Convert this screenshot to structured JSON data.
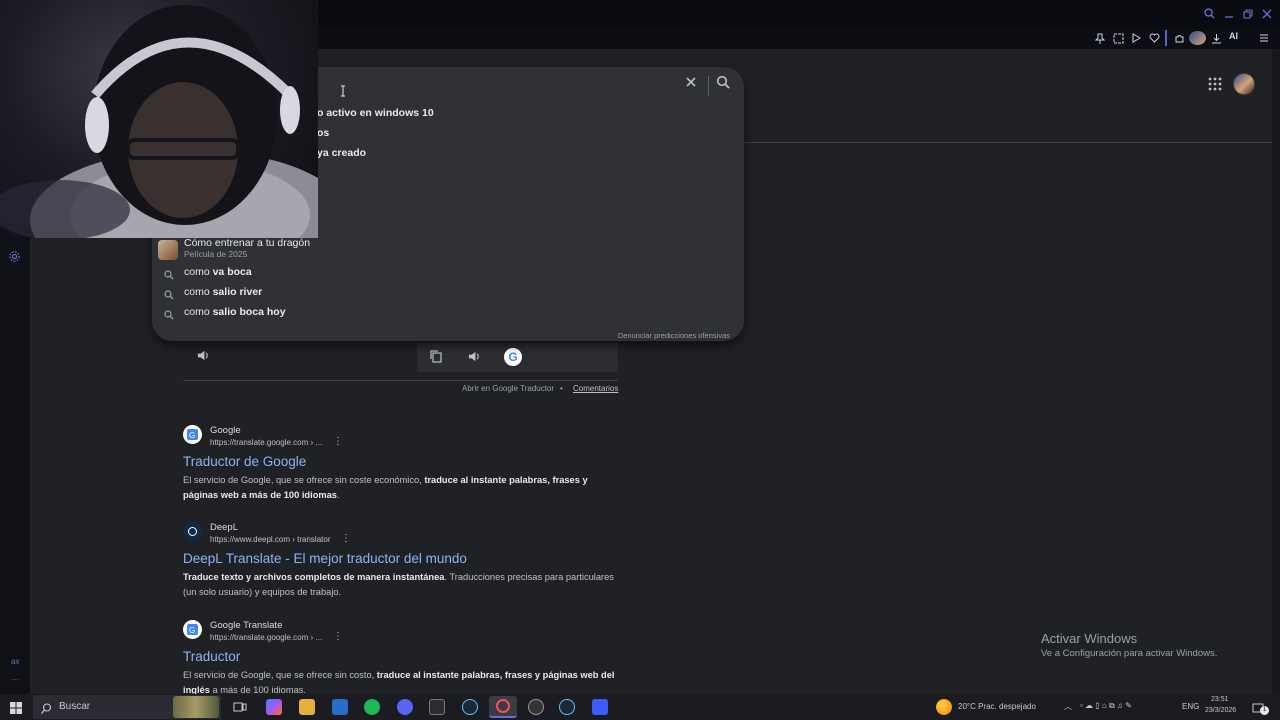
{
  "search": {
    "value": "",
    "suggestions": [
      {
        "prefix": "",
        "bold": "o activo en windows 10"
      },
      {
        "prefix": "",
        "bold": "os"
      },
      {
        "prefix": "",
        "bold": "ya creado"
      }
    ],
    "entity": {
      "title": "Cómo entrenar a tu dragón",
      "subtitle": "Película de 2025"
    },
    "suggestions2": [
      {
        "prefix": "como ",
        "bold": "va boca"
      },
      {
        "prefix": "como ",
        "bold": "salio river"
      },
      {
        "prefix": "como ",
        "bold": "salio boca hoy"
      }
    ],
    "report_link": "Denunciar predicciones ofensivas"
  },
  "translator": {
    "open_link": "Abrir en Google Traductor",
    "separator": "•",
    "feedback_link": "Comentarios",
    "google_letter": "G"
  },
  "results": [
    {
      "site": "Google",
      "url": "https://translate.google.com › ...",
      "title": "Traductor de Google",
      "snippet_pre": "El servicio de Google, que se ofrece sin coste económico, ",
      "snippet_bold": "traduce al instante palabras, frases y páginas web a más de 100 idiomas",
      "snippet_post": "."
    },
    {
      "site": "DeepL",
      "url": "https://www.deepl.com › translator",
      "title": "DeepL Translate - El mejor traductor del mundo",
      "snippet_pre": "",
      "snippet_bold": "Traduce texto y archivos completos de manera instantánea",
      "snippet_post": ". Traducciones precisas para particulares (un solo usuario) y equipos de trabajo."
    },
    {
      "site": "Google Translate",
      "url": "https://translate.google.com › ...",
      "title": "Traductor",
      "snippet_pre": "El servicio de Google, que se ofrece sin costo, ",
      "snippet_bold": "traduce al instante palabras, frases y páginas web del inglés",
      "snippet_post": " a más de 100 idiomas."
    }
  ],
  "watermark": {
    "title": "Activar Windows",
    "subtitle": "Ve a Configuración para activar Windows."
  },
  "browser": {
    "ai_label": "AI"
  },
  "sidebar": {
    "bottom_label": "ax"
  },
  "taskbar": {
    "search_label": "Buscar",
    "weather": "20°C  Prac. despejado",
    "lang": "ENG",
    "time": "23:51",
    "date": "23/3/2026",
    "notif_count": "1"
  },
  "colors": {
    "link": "#8ab4f8",
    "page_bg": "#202124",
    "accent": "#6b6fd1"
  }
}
